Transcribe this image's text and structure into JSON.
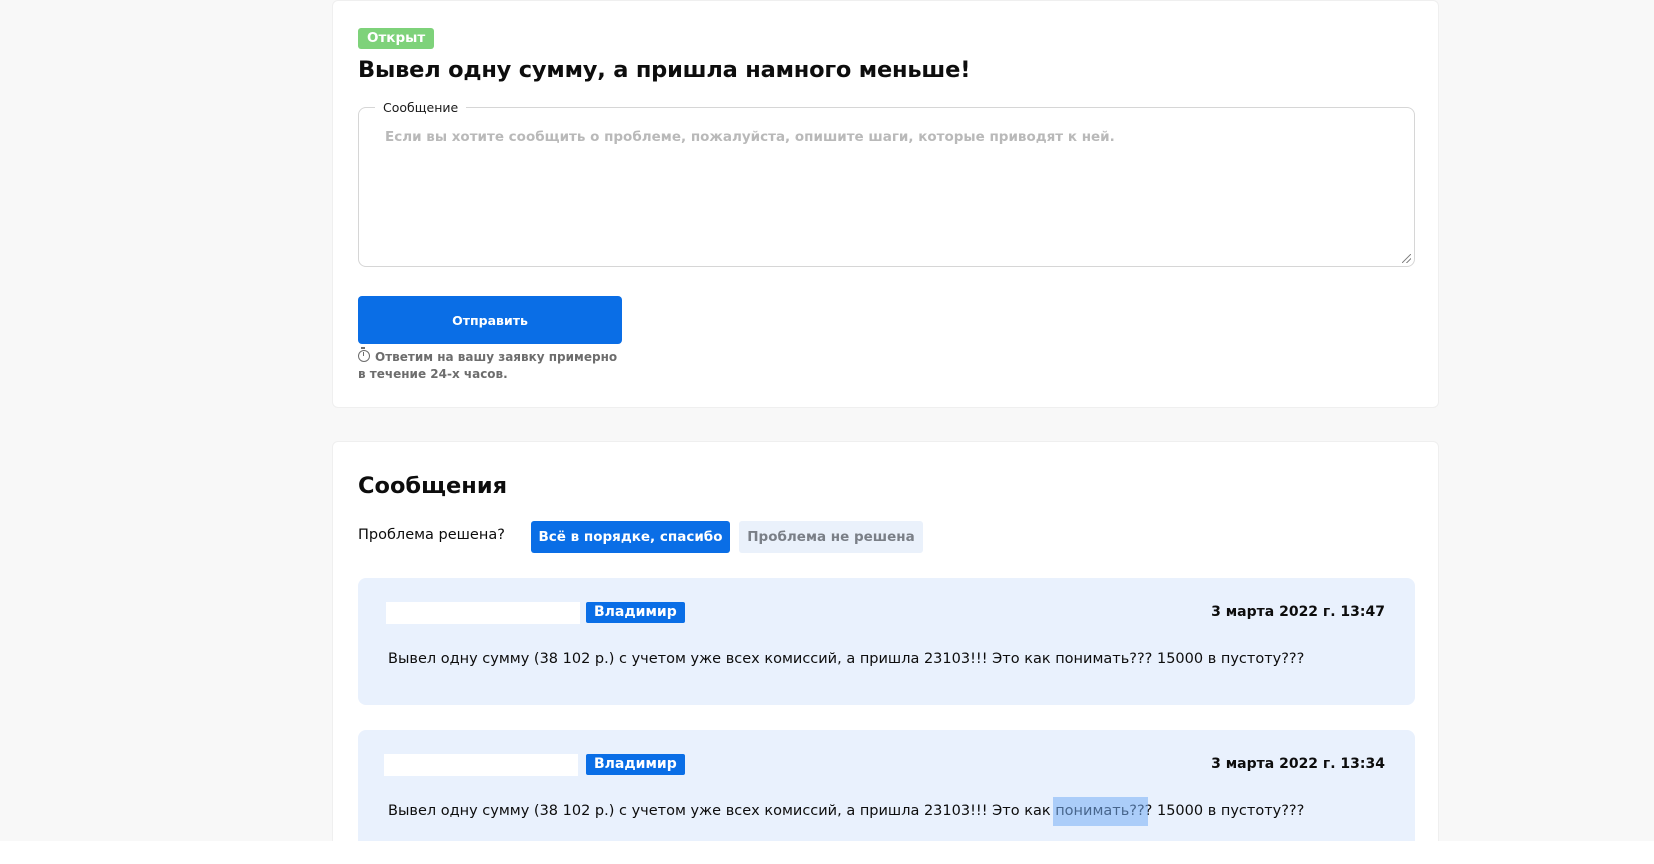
{
  "ticket": {
    "status": "Открыт",
    "title": "Вывел одну сумму, а пришла намного меньше!",
    "message_legend": "Сообщение",
    "message_placeholder": "Если вы хотите сообщить о проблеме, пожалуйста, опишите шаги, которые приводят к ней.",
    "message_value": "",
    "send_label": "Отправить",
    "response_note": "Ответим на вашу заявку примерно в течение 24-х часов."
  },
  "messages": {
    "title": "Сообщения",
    "resolved_question": "Проблема решена?",
    "resolved_yes_label": "Всё в порядке, спасибо",
    "resolved_no_label": "Проблема не решена",
    "items": [
      {
        "author": "Владимир",
        "date": "3 марта 2022 г. 13:47",
        "text": "Вывел одну сумму (38 102 р.) с учетом уже всех комиссий, а пришла 23103!!! Это как понимать??? 15000 в пустоту???"
      },
      {
        "author": "Владимир",
        "date": "3 марта 2022 г. 13:34",
        "text": "Вывел одну сумму (38 102 р.) с учетом уже всех комиссий, а пришла 23103!!! Это как понимать??? 15000 в пустоту???"
      }
    ]
  },
  "colors": {
    "accent": "#0a6ee6",
    "status_open": "#7ed27a",
    "message_bg": "#e9f1fd",
    "page_bg": "#f8f8f8"
  },
  "icons": {
    "response_note_icon": "timer-icon"
  }
}
